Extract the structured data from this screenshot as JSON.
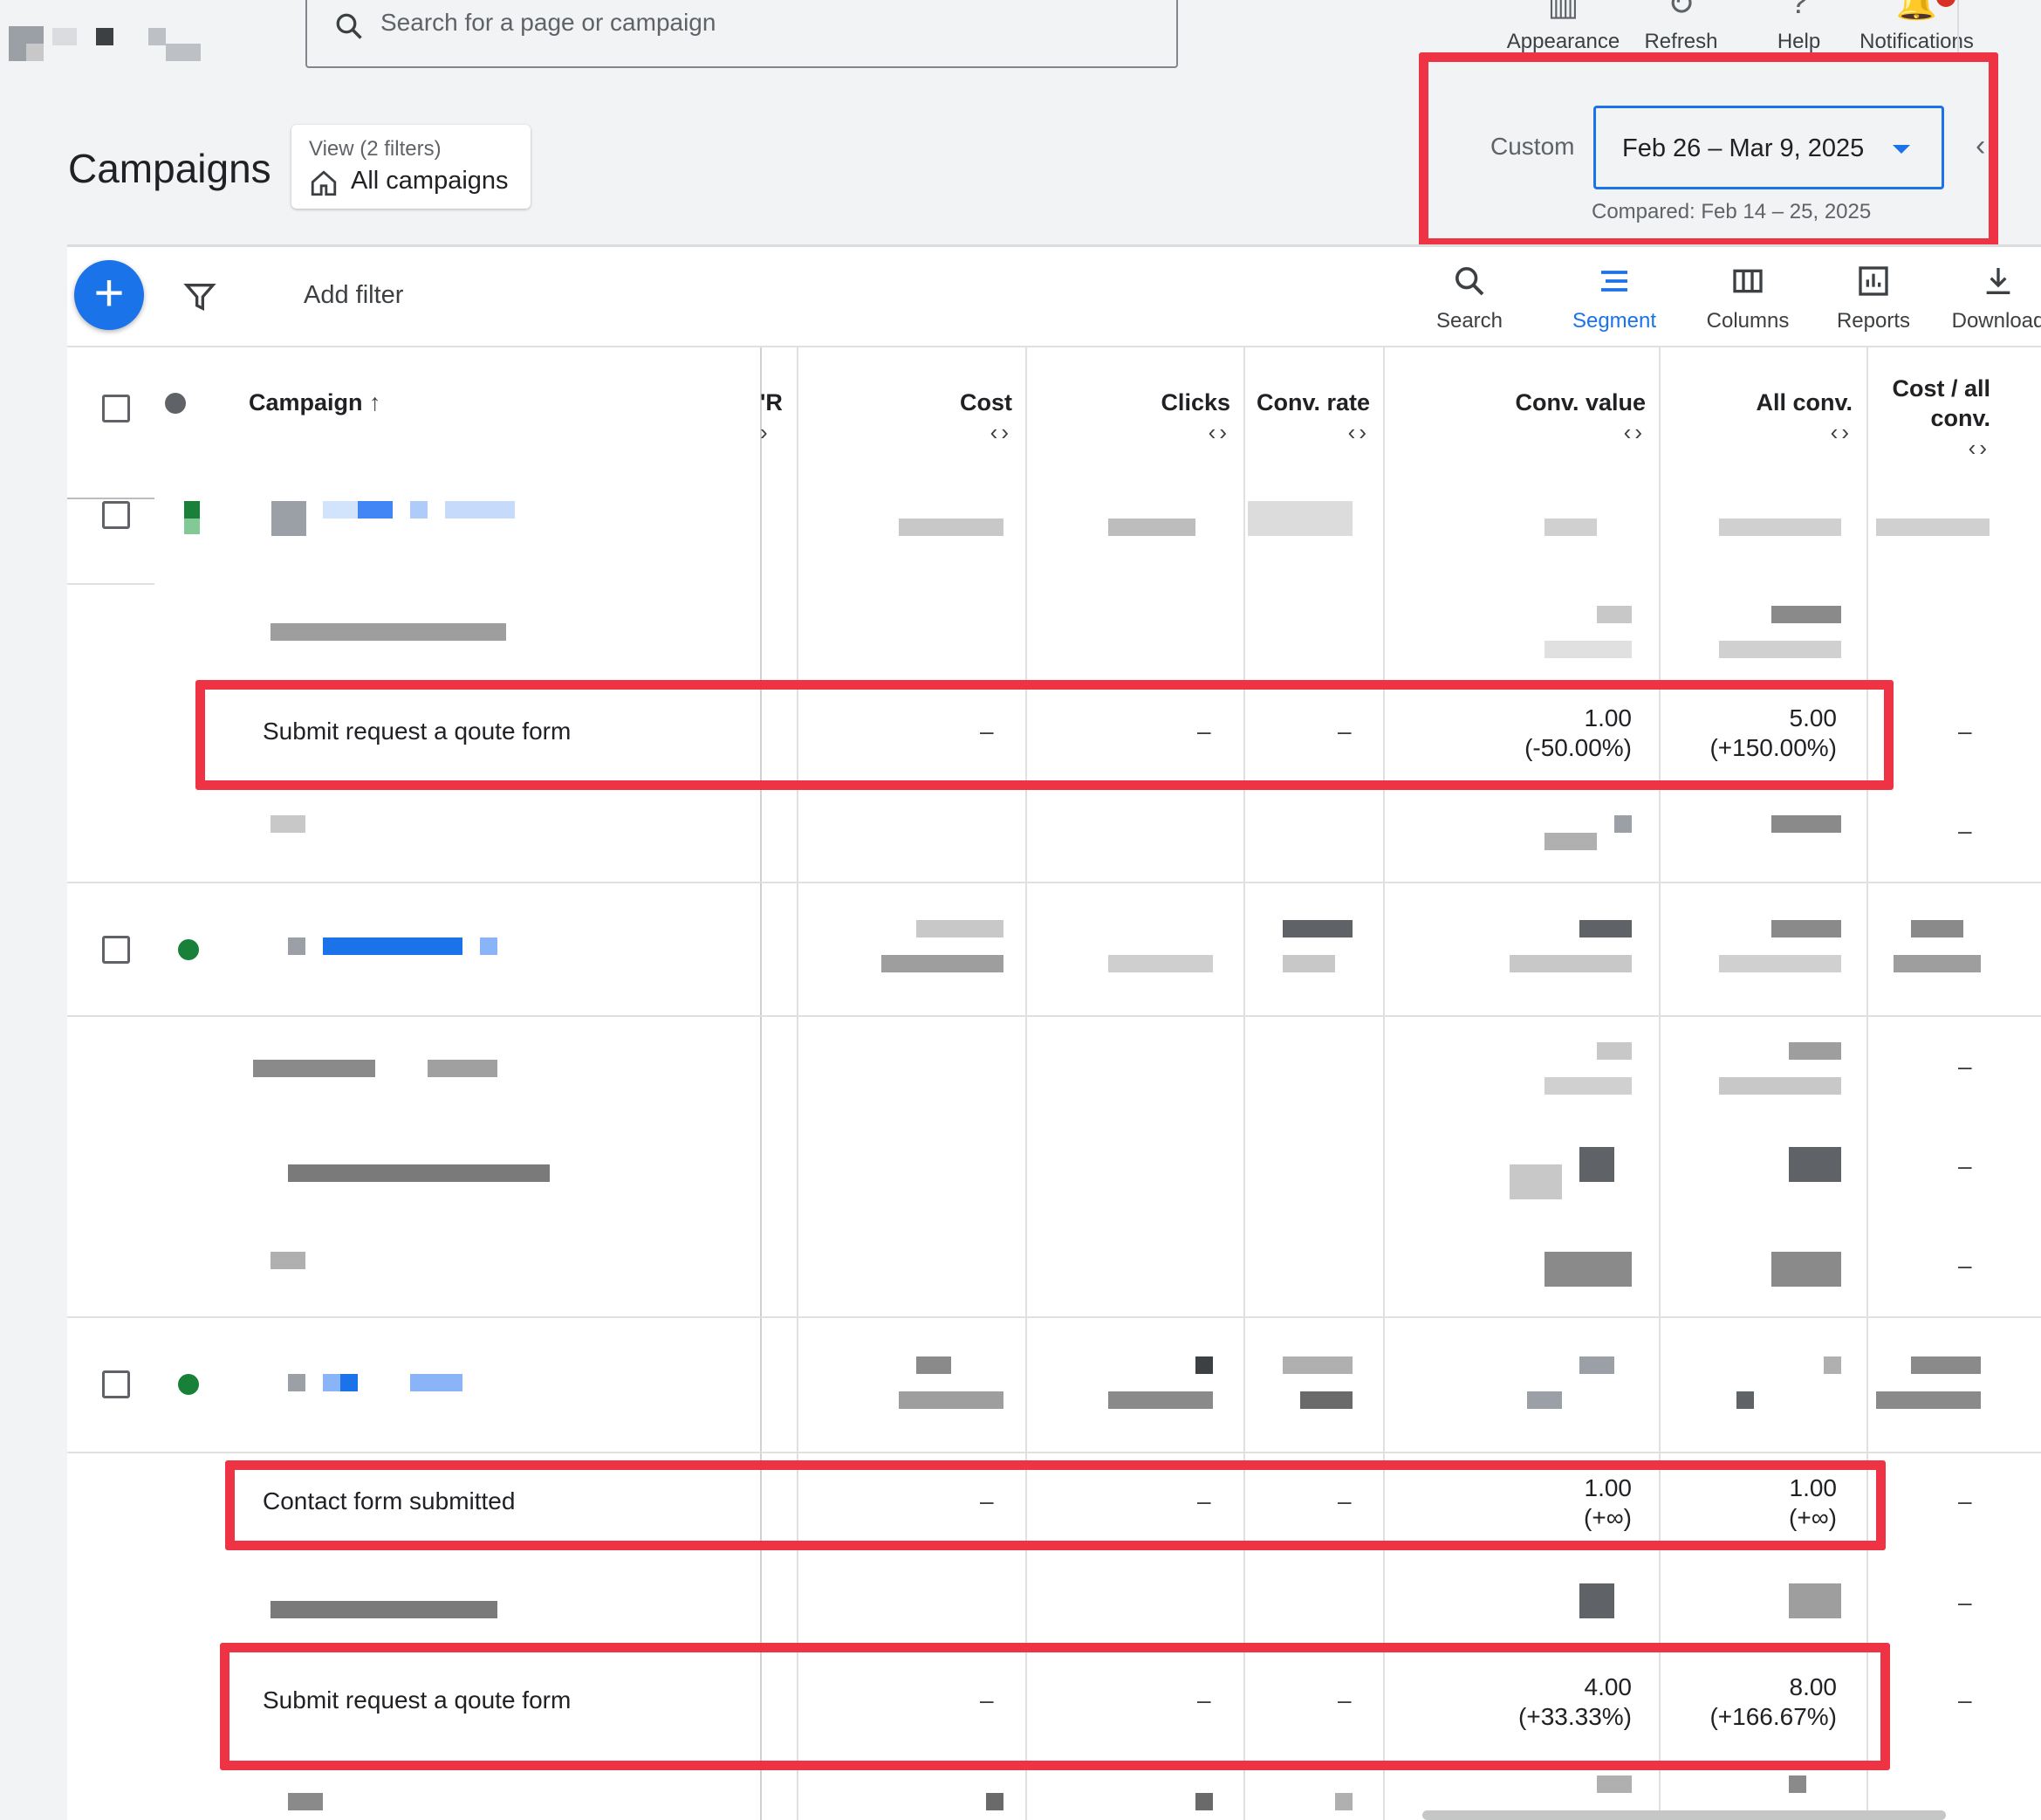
{
  "search": {
    "placeholder": "Search for a page or campaign"
  },
  "top_actions": [
    {
      "label": "Appearance",
      "icon": "appearance-icon"
    },
    {
      "label": "Refresh",
      "icon": "refresh-icon"
    },
    {
      "label": "Help",
      "icon": "help-icon"
    },
    {
      "label": "Notifications",
      "icon": "notifications-icon"
    }
  ],
  "page": {
    "title": "Campaigns"
  },
  "view": {
    "sub": "View (2 filters)",
    "main": "All campaigns"
  },
  "date": {
    "preset": "Custom",
    "range": "Feb 26 – Mar 9, 2025",
    "compared": "Compared: Feb 14 – 25, 2025"
  },
  "toolbar": {
    "add_filter": "Add filter",
    "tools": [
      {
        "label": "Search",
        "active": false
      },
      {
        "label": "Segment",
        "active": true
      },
      {
        "label": "Columns",
        "active": false
      },
      {
        "label": "Reports",
        "active": false
      },
      {
        "label": "Download",
        "active": false
      }
    ]
  },
  "columns": {
    "campaign": "Campaign",
    "ctr_partial": "'R",
    "cost": "Cost",
    "clicks": "Clicks",
    "conv_rate": "Conv. rate",
    "conv_value": "Conv. value",
    "all_conv": "All conv.",
    "cost_all_conv_1": "Cost / all",
    "cost_all_conv_2": "conv."
  },
  "rows": {
    "r1": {
      "name": "Submit request a qoute form",
      "cost": "–",
      "clicks": "–",
      "conv_rate": "–",
      "conv_value": "1.00",
      "conv_value_delta": "(-50.00%)",
      "all_conv": "5.00",
      "all_conv_delta": "(+150.00%)",
      "cost_all": "–"
    },
    "r2": {
      "name": "Contact form submitted",
      "cost": "–",
      "clicks": "–",
      "conv_rate": "–",
      "conv_value": "1.00",
      "conv_value_delta": "(+∞)",
      "all_conv": "1.00",
      "all_conv_delta": "(+∞)",
      "cost_all": "–"
    },
    "r3": {
      "name": "Submit request a qoute form",
      "cost": "–",
      "clicks": "–",
      "conv_rate": "–",
      "conv_value": "4.00",
      "conv_value_delta": "(+33.33%)",
      "all_conv": "8.00",
      "all_conv_delta": "(+166.67%)",
      "cost_all": "–"
    }
  },
  "dash": "–",
  "colors": {
    "accent": "#1a73e8",
    "highlight": "#ee3344",
    "status_green": "#188038"
  }
}
